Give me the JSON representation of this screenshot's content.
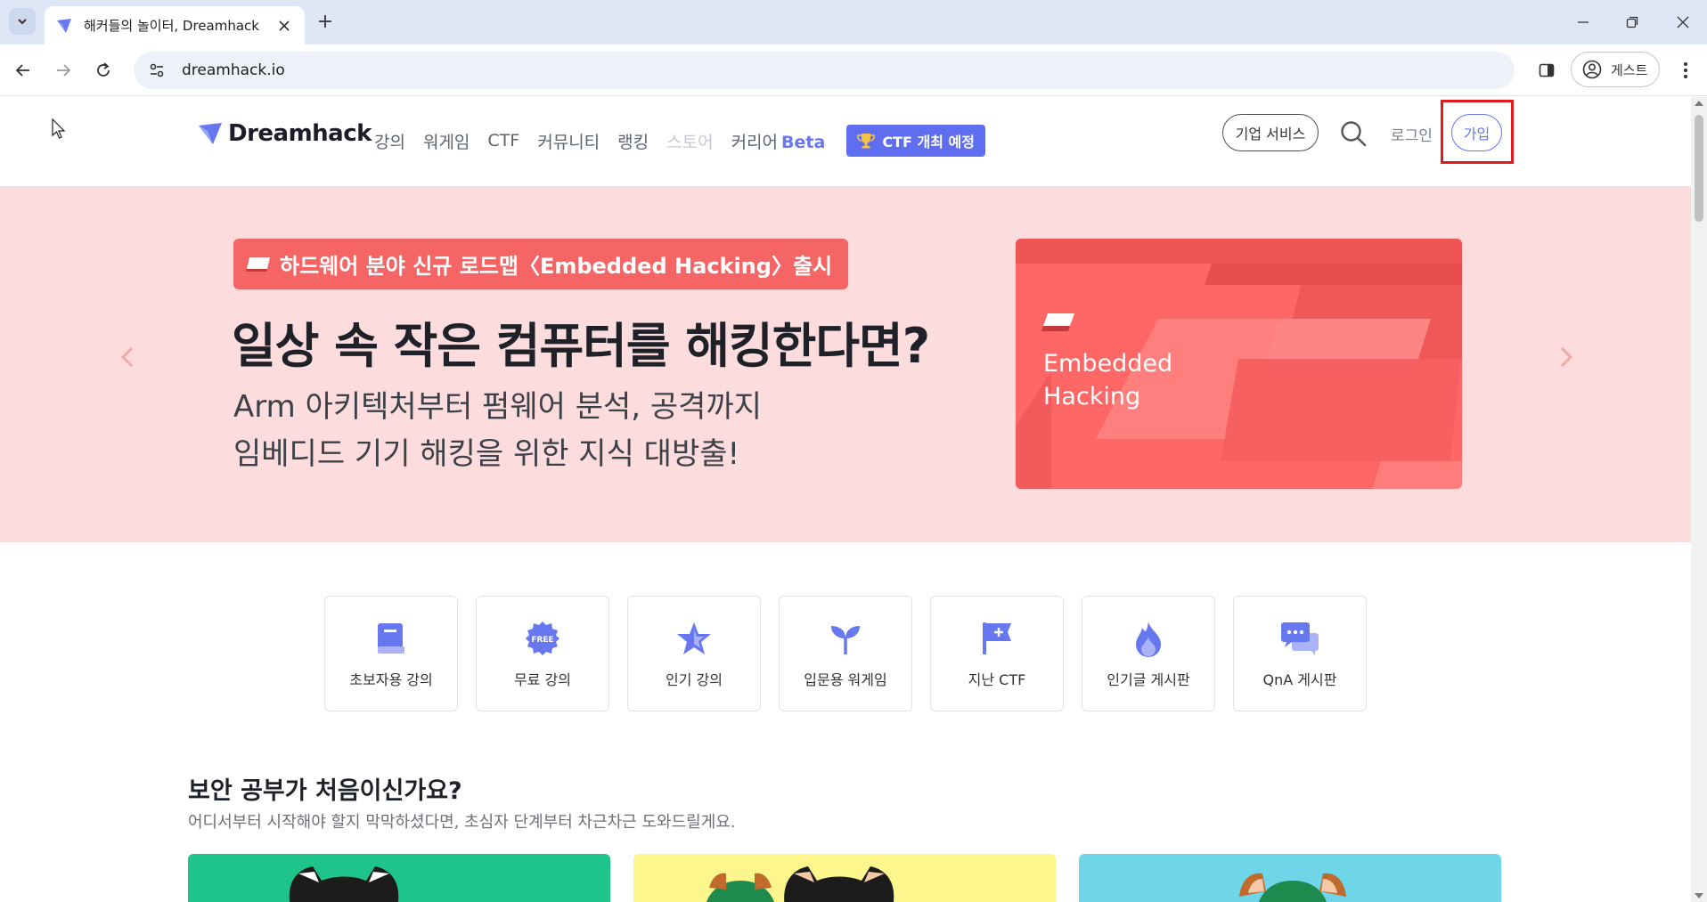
{
  "browser": {
    "tab_title": "해커들의 놀이터, Dreamhack",
    "url": "dreamhack.io",
    "profile_label": "게스트"
  },
  "header": {
    "logo_text": "Dreamhack",
    "nav": [
      {
        "label": "강의"
      },
      {
        "label": "워게임"
      },
      {
        "label": "CTF"
      },
      {
        "label": "커뮤니티"
      },
      {
        "label": "랭킹"
      },
      {
        "label": "스토어"
      },
      {
        "label": "커리어"
      }
    ],
    "career_badge": "Beta",
    "ctf_badge": "CTF 개최 예정",
    "business_button": "기업 서비스",
    "login_label": "로그인",
    "signup_label": "가입"
  },
  "hero": {
    "badge": "하드웨어 분야 신규 로드맵〈Embedded Hacking〉출시",
    "title": "일상 속 작은 컴퓨터를 해킹한다면?",
    "subtitle_line1": "Arm 아키텍처부터 펌웨어 분석, 공격까지",
    "subtitle_line2": "임베디드 기기 해킹을 위한 지식 대방출!",
    "card_label_line1": "Embedded",
    "card_label_line2": "Hacking"
  },
  "quick_links": [
    {
      "label": "초보자용 강의",
      "icon": "book-icon"
    },
    {
      "label": "무료 강의",
      "icon": "free-badge-icon"
    },
    {
      "label": "인기 강의",
      "icon": "star-icon"
    },
    {
      "label": "입문용 워게임",
      "icon": "sprout-icon"
    },
    {
      "label": "지난 CTF",
      "icon": "flag-icon"
    },
    {
      "label": "인기글 게시판",
      "icon": "fire-icon"
    },
    {
      "label": "QnA 게시판",
      "icon": "chat-icon"
    }
  ],
  "section": {
    "title": "보안 공부가 처음이신가요?",
    "description": "어디서부터 시작해야 할지 막막하셨다면, 초심자 단계부터 차근차근 도와드릴게요."
  },
  "colors": {
    "brand": "#6677f0",
    "hero_bg": "#fcdcdc",
    "hero_badge": "#f56565",
    "highlight": "#e41a1a",
    "card_green": "#1fc48b",
    "card_yellow": "#fdf68c",
    "card_cyan": "#6fd5e8"
  }
}
